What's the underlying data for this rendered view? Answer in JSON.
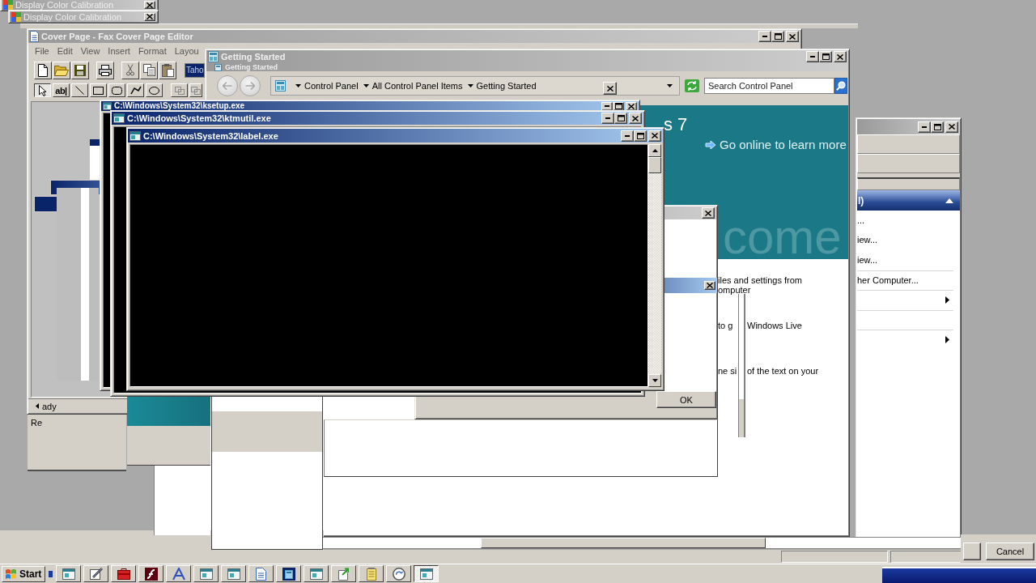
{
  "calibration_windows": [
    {
      "title": "Display Color Calibration",
      "active": false
    },
    {
      "title": "Display Color Calibration",
      "active": false
    }
  ],
  "fax_editor": {
    "title": "Cover Page - Fax Cover Page Editor",
    "active": false,
    "menu": [
      "File",
      "Edit",
      "View",
      "Insert",
      "Format",
      "Layou"
    ],
    "font_box": "Taho",
    "tools": [
      {
        "kind": "pointer",
        "selected": true,
        "disabled": false
      },
      {
        "kind": "text",
        "label": "ab|",
        "selected": false,
        "disabled": false
      },
      {
        "kind": "line",
        "selected": false,
        "disabled": false
      },
      {
        "kind": "rectangle",
        "selected": false,
        "disabled": false
      },
      {
        "kind": "rounded-rectangle",
        "selected": false,
        "disabled": false
      },
      {
        "kind": "polyline",
        "selected": false,
        "disabled": false
      },
      {
        "kind": "ellipse",
        "selected": false,
        "disabled": false
      },
      {
        "kind": "arrange",
        "selected": false,
        "disabled": true
      },
      {
        "kind": "arrange",
        "selected": false,
        "disabled": true
      }
    ],
    "status": "ady",
    "status_2": "Re"
  },
  "getting_started": {
    "title": "Getting Started",
    "active": false,
    "ghost_title": "Getting Started",
    "breadcrumb": [
      "Control Panel",
      "All Control Panel Items",
      "Getting Started"
    ],
    "search": {
      "placeholder": "Search Control Panel"
    },
    "banner": {
      "heading": "s 7",
      "link": "Go online to learn more",
      "watermark": "come"
    },
    "items": [
      {
        "column_1": "iles and settings from\nomputer"
      },
      {
        "column_1": "to g",
        "column_2": "Windows Live"
      },
      {
        "column_1": "ne si",
        "column_2": "of the text on your"
      }
    ]
  },
  "dialog": {
    "active": false,
    "button": "OK"
  },
  "console_windows": [
    {
      "title": "C:\\Windows\\System32\\ksetup.exe",
      "active": true
    },
    {
      "title": "C:\\Windows\\System32\\ktmutil.exe",
      "active": true
    },
    {
      "title": "C:\\Windows\\System32\\label.exe",
      "active": true
    }
  ],
  "side_window": {
    "active": false,
    "header": "l)",
    "expanded": true,
    "items": [
      {
        "kind": "link",
        "label": "..."
      },
      {
        "kind": "link",
        "label": "iew..."
      },
      {
        "kind": "link",
        "label": "iew..."
      },
      {
        "kind": "link",
        "label": "her Computer..."
      },
      {
        "kind": "submenu"
      },
      {
        "kind": "submenu"
      }
    ]
  },
  "cancel_dialog": {
    "button": "Cancel"
  },
  "taskbar": {
    "start": "Start",
    "buttons": [
      {
        "kind": "window",
        "selected": false
      },
      {
        "kind": "pencil",
        "selected": false
      },
      {
        "kind": "toolbox",
        "selected": false
      },
      {
        "kind": "letter-f",
        "selected": false
      },
      {
        "kind": "letter-a",
        "selected": false
      },
      {
        "kind": "window",
        "selected": false
      },
      {
        "kind": "window",
        "selected": false
      },
      {
        "kind": "document",
        "selected": false
      },
      {
        "kind": "window-tile",
        "selected": false
      },
      {
        "kind": "window",
        "selected": false
      },
      {
        "kind": "document-arrow",
        "selected": false
      },
      {
        "kind": "notepad",
        "selected": false
      },
      {
        "kind": "circle-arrow",
        "selected": false
      },
      {
        "kind": "window",
        "selected": true
      }
    ]
  }
}
